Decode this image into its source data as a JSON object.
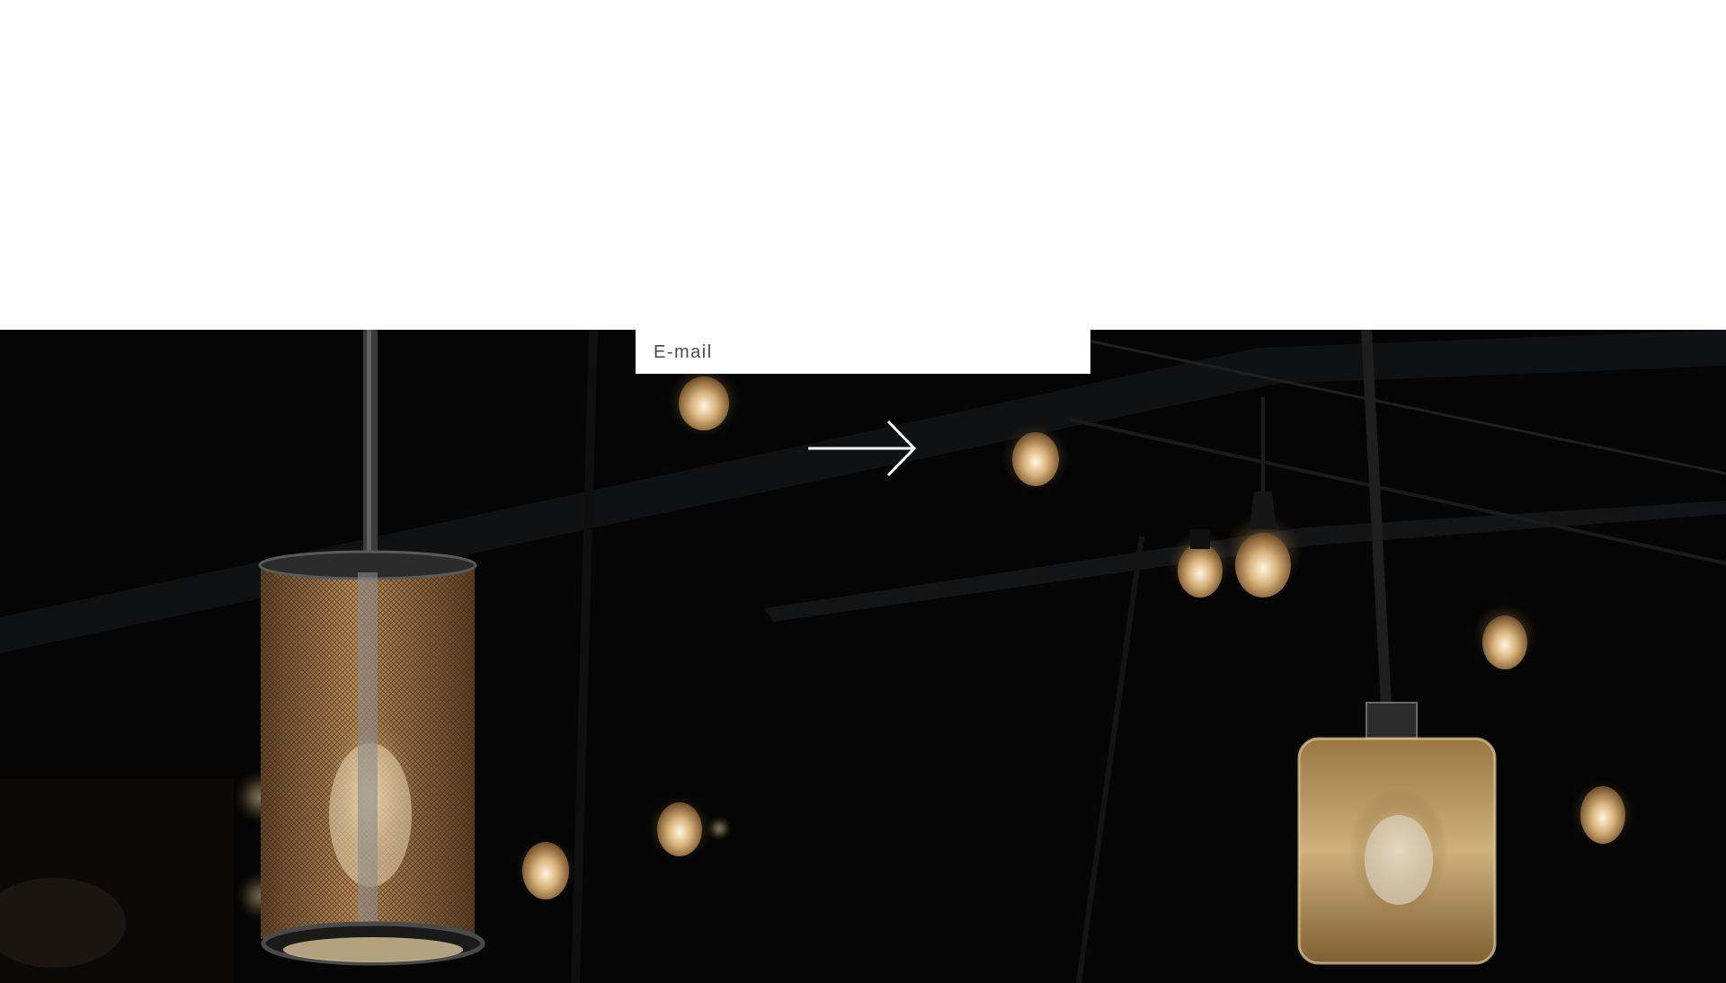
{
  "newsletter": {
    "email_placeholder": "E-mail",
    "email_value": "",
    "submit_icon": "arrow-right-icon"
  },
  "hero": {
    "image_subject": "hanging-edison-light-bulbs",
    "background_color": "#040404"
  },
  "colors": {
    "page_background": "#ffffff",
    "arrow": "#ffffff",
    "bulb_glow": "#f3d7a0",
    "warm_amber": "#b8844a"
  }
}
